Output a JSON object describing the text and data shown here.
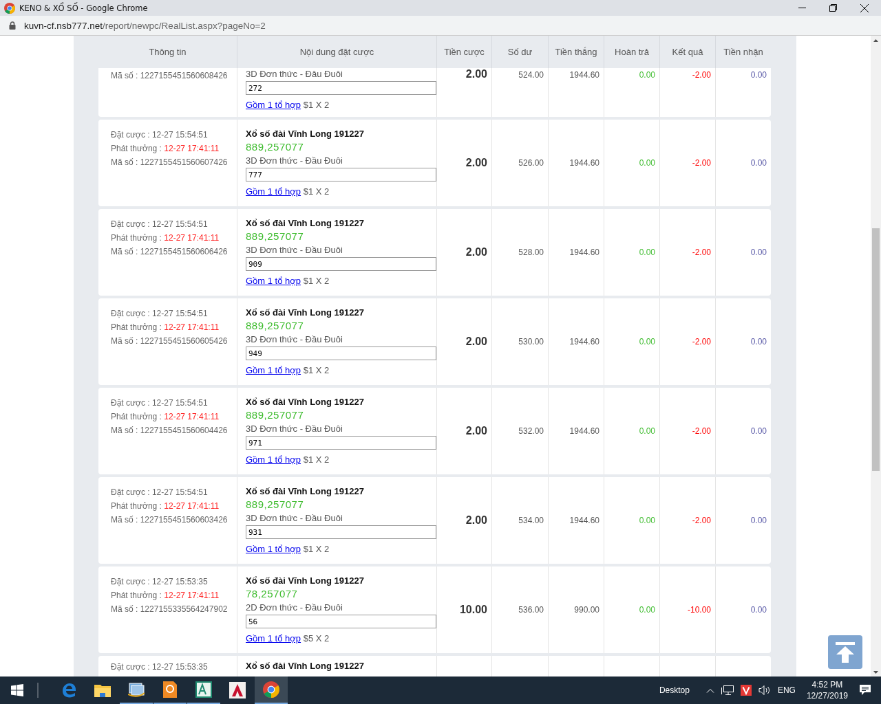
{
  "window": {
    "title": "KENO & XỔ SỐ - Google Chrome"
  },
  "address_bar": {
    "domain": "kuvn-cf.nsb777.net",
    "path": "/report/newpc/RealList.aspx?pageNo=2"
  },
  "table": {
    "columns": [
      "Thông tin",
      "Nội dung đặt cược",
      "Tiền cược",
      "Số dư",
      "Tiền thắng",
      "Hoàn trả",
      "Kết quả",
      "Tiền nhận"
    ],
    "rows": [
      {
        "kind": "cut_top",
        "info": [
          {
            "label": "Mã số :",
            "value": "1227155451560608426",
            "kind": "plain"
          }
        ],
        "bet_type": "3D Đơn thức - Đâu Đuôi",
        "numbers": "272",
        "combo_link": "Gồm 1 tổ hợp",
        "combo_detail": "$1 X 2",
        "stake": "2.00",
        "balance": "524.00",
        "winnings": "1944.60",
        "refund": "0.00",
        "result": "-2.00",
        "received": "0.00"
      },
      {
        "kind": "full",
        "info": [
          {
            "label": "Đặt cược :",
            "value": "12-27 15:54:51",
            "kind": "plain"
          },
          {
            "label": "Phát thưởng :",
            "value": "12-27 17:41:11",
            "kind": "highlight"
          },
          {
            "label": "Mã số :",
            "value": "1227155451560607426",
            "kind": "plain"
          }
        ],
        "title": "Xổ số đài Vĩnh Long 191227",
        "draw_result": "889,257077",
        "bet_type": "3D Đơn thức - Đầu Đuôi",
        "numbers": "777",
        "combo_link": "Gồm 1 tổ hợp",
        "combo_detail": "$1 X 2",
        "stake": "2.00",
        "balance": "526.00",
        "winnings": "1944.60",
        "refund": "0.00",
        "result": "-2.00",
        "received": "0.00"
      },
      {
        "kind": "full",
        "info": [
          {
            "label": "Đặt cược :",
            "value": "12-27 15:54:51",
            "kind": "plain"
          },
          {
            "label": "Phát thưởng :",
            "value": "12-27 17:41:11",
            "kind": "highlight"
          },
          {
            "label": "Mã số :",
            "value": "1227155451560606426",
            "kind": "plain"
          }
        ],
        "title": "Xổ số đài Vĩnh Long 191227",
        "draw_result": "889,257077",
        "bet_type": "3D Đơn thức - Đầu Đuôi",
        "numbers": "909",
        "combo_link": "Gồm 1 tổ hợp",
        "combo_detail": "$1 X 2",
        "stake": "2.00",
        "balance": "528.00",
        "winnings": "1944.60",
        "refund": "0.00",
        "result": "-2.00",
        "received": "0.00"
      },
      {
        "kind": "full",
        "info": [
          {
            "label": "Đặt cược :",
            "value": "12-27 15:54:51",
            "kind": "plain"
          },
          {
            "label": "Phát thưởng :",
            "value": "12-27 17:41:11",
            "kind": "highlight"
          },
          {
            "label": "Mã số :",
            "value": "1227155451560605426",
            "kind": "plain"
          }
        ],
        "title": "Xổ số đài Vĩnh Long 191227",
        "draw_result": "889,257077",
        "bet_type": "3D Đơn thức - Đầu Đuôi",
        "numbers": "949",
        "combo_link": "Gồm 1 tổ hợp",
        "combo_detail": "$1 X 2",
        "stake": "2.00",
        "balance": "530.00",
        "winnings": "1944.60",
        "refund": "0.00",
        "result": "-2.00",
        "received": "0.00"
      },
      {
        "kind": "full",
        "info": [
          {
            "label": "Đặt cược :",
            "value": "12-27 15:54:51",
            "kind": "plain"
          },
          {
            "label": "Phát thưởng :",
            "value": "12-27 17:41:11",
            "kind": "highlight"
          },
          {
            "label": "Mã số :",
            "value": "1227155451560604426",
            "kind": "plain"
          }
        ],
        "title": "Xổ số đài Vĩnh Long 191227",
        "draw_result": "889,257077",
        "bet_type": "3D Đơn thức - Đầu Đuôi",
        "numbers": "971",
        "combo_link": "Gồm 1 tổ hợp",
        "combo_detail": "$1 X 2",
        "stake": "2.00",
        "balance": "532.00",
        "winnings": "1944.60",
        "refund": "0.00",
        "result": "-2.00",
        "received": "0.00"
      },
      {
        "kind": "full",
        "info": [
          {
            "label": "Đặt cược :",
            "value": "12-27 15:54:51",
            "kind": "plain"
          },
          {
            "label": "Phát thưởng :",
            "value": "12-27 17:41:11",
            "kind": "highlight"
          },
          {
            "label": "Mã số :",
            "value": "1227155451560603426",
            "kind": "plain"
          }
        ],
        "title": "Xổ số đài Vĩnh Long 191227",
        "draw_result": "889,257077",
        "bet_type": "3D Đơn thức - Đầu Đuôi",
        "numbers": "931",
        "combo_link": "Gồm 1 tổ hợp",
        "combo_detail": "$1 X 2",
        "stake": "2.00",
        "balance": "534.00",
        "winnings": "1944.60",
        "refund": "0.00",
        "result": "-2.00",
        "received": "0.00"
      },
      {
        "kind": "full",
        "info": [
          {
            "label": "Đặt cược :",
            "value": "12-27 15:53:35",
            "kind": "plain"
          },
          {
            "label": "Phát thưởng :",
            "value": "12-27 17:41:11",
            "kind": "highlight"
          },
          {
            "label": "Mã số :",
            "value": "1227155335564247902",
            "kind": "plain"
          }
        ],
        "title": "Xổ số đài Vĩnh Long 191227",
        "draw_result": "78,257077",
        "bet_type": "2D Đơn thức - Đầu Đuôi",
        "numbers": "56",
        "combo_link": "Gồm 1 tổ hợp",
        "combo_detail": "$5 X 2",
        "stake": "10.00",
        "balance": "536.00",
        "winnings": "990.00",
        "refund": "0.00",
        "result": "-10.00",
        "received": "0.00"
      },
      {
        "kind": "cut_bottom",
        "info": [
          {
            "label": "Đặt cược :",
            "value": "12-27 15:53:35",
            "kind": "plain"
          }
        ],
        "title": "Xổ số đài Vĩnh Long 191227"
      }
    ]
  },
  "taskbar": {
    "desktop_label": "Desktop",
    "language": "ENG",
    "time": "4:52 PM",
    "date": "12/27/2019"
  }
}
